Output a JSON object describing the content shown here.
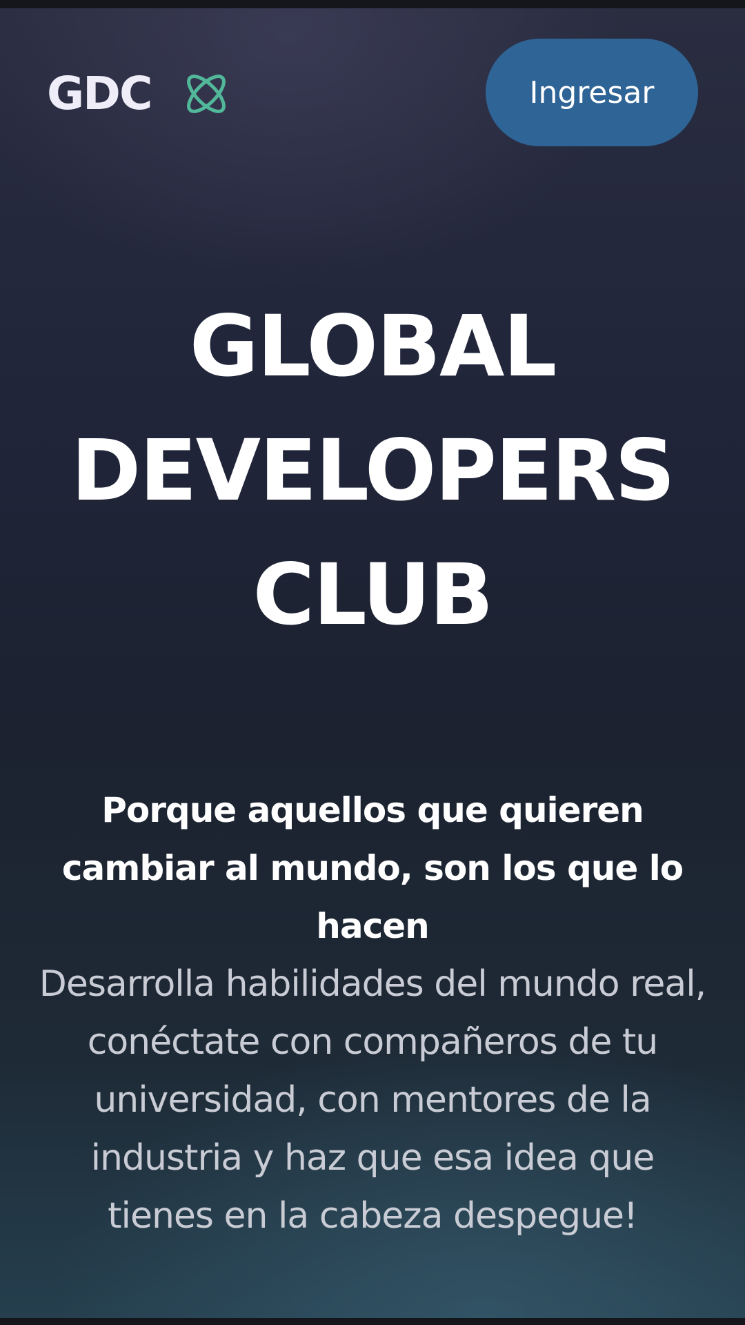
{
  "header": {
    "brand": "GDC",
    "brand_icon": "atom-orbit-icon",
    "login_label": "Ingresar"
  },
  "hero": {
    "title_lines": [
      "GLOBAL",
      "DEVELOPERS",
      "CLUB"
    ],
    "tagline": "Porque aquellos que quieren cambiar al mundo, son los que lo hacen",
    "description": "Desarrolla habilidades del mundo real, conéctate con compañeros de tu universidad, con mentores de la industria y haz que esa idea que tienes en la cabeza despegue!"
  },
  "colors": {
    "accent": "#2f6496",
    "icon": "#52b89a",
    "background": "#1f2433"
  }
}
